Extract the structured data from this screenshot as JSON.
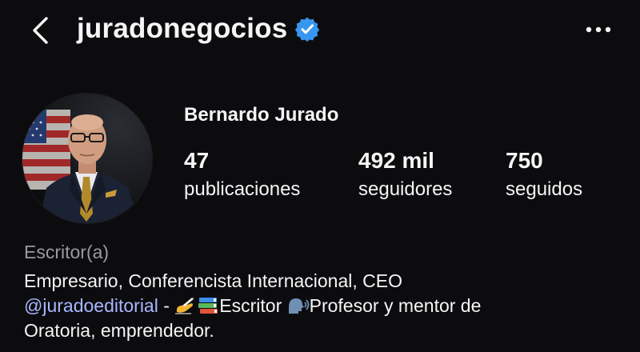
{
  "header": {
    "username": "juradonegocios",
    "back_icon": "chevron-left-icon",
    "verified_icon": "verified-badge-icon",
    "more_icon": "more-horizontal-icon"
  },
  "profile": {
    "name": "Bernardo Jurado",
    "stats": {
      "posts": {
        "count": "47",
        "label": "publicaciones"
      },
      "followers": {
        "count": "492 mil",
        "label": "seguidores"
      },
      "following": {
        "count": "750",
        "label": "seguidos"
      }
    },
    "category": "Escritor(a)",
    "bio": {
      "line1": "Empresario, Conferencista Internacional, CEO",
      "mention": "@juradoeditorial",
      "dash": " - ",
      "writer_text": "Escritor ",
      "teacher_text": "Profesor y mentor de",
      "line3": "Oratoria, emprendedor."
    }
  },
  "colors": {
    "background": "#0c0c0f",
    "text": "#f5f5f5",
    "secondary": "#9a9aa0",
    "link": "#a9b7ff",
    "verified": "#3797f0"
  }
}
